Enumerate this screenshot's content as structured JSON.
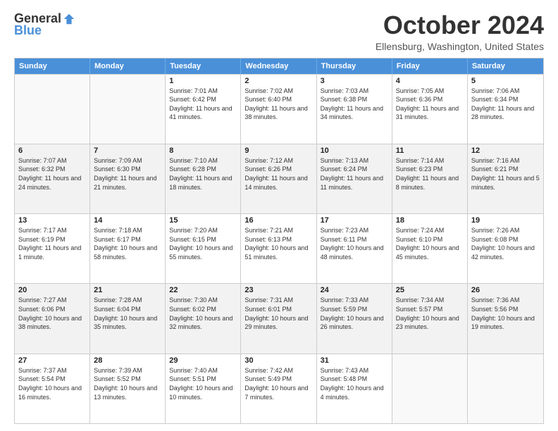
{
  "logo": {
    "general": "General",
    "blue": "Blue"
  },
  "title": "October 2024",
  "location": "Ellensburg, Washington, United States",
  "days_of_week": [
    "Sunday",
    "Monday",
    "Tuesday",
    "Wednesday",
    "Thursday",
    "Friday",
    "Saturday"
  ],
  "weeks": [
    [
      {
        "day": "",
        "empty": true
      },
      {
        "day": "",
        "empty": true
      },
      {
        "day": "1",
        "sunrise": "Sunrise: 7:01 AM",
        "sunset": "Sunset: 6:42 PM",
        "daylight": "Daylight: 11 hours and 41 minutes."
      },
      {
        "day": "2",
        "sunrise": "Sunrise: 7:02 AM",
        "sunset": "Sunset: 6:40 PM",
        "daylight": "Daylight: 11 hours and 38 minutes."
      },
      {
        "day": "3",
        "sunrise": "Sunrise: 7:03 AM",
        "sunset": "Sunset: 6:38 PM",
        "daylight": "Daylight: 11 hours and 34 minutes."
      },
      {
        "day": "4",
        "sunrise": "Sunrise: 7:05 AM",
        "sunset": "Sunset: 6:36 PM",
        "daylight": "Daylight: 11 hours and 31 minutes."
      },
      {
        "day": "5",
        "sunrise": "Sunrise: 7:06 AM",
        "sunset": "Sunset: 6:34 PM",
        "daylight": "Daylight: 11 hours and 28 minutes."
      }
    ],
    [
      {
        "day": "6",
        "sunrise": "Sunrise: 7:07 AM",
        "sunset": "Sunset: 6:32 PM",
        "daylight": "Daylight: 11 hours and 24 minutes."
      },
      {
        "day": "7",
        "sunrise": "Sunrise: 7:09 AM",
        "sunset": "Sunset: 6:30 PM",
        "daylight": "Daylight: 11 hours and 21 minutes."
      },
      {
        "day": "8",
        "sunrise": "Sunrise: 7:10 AM",
        "sunset": "Sunset: 6:28 PM",
        "daylight": "Daylight: 11 hours and 18 minutes."
      },
      {
        "day": "9",
        "sunrise": "Sunrise: 7:12 AM",
        "sunset": "Sunset: 6:26 PM",
        "daylight": "Daylight: 11 hours and 14 minutes."
      },
      {
        "day": "10",
        "sunrise": "Sunrise: 7:13 AM",
        "sunset": "Sunset: 6:24 PM",
        "daylight": "Daylight: 11 hours and 11 minutes."
      },
      {
        "day": "11",
        "sunrise": "Sunrise: 7:14 AM",
        "sunset": "Sunset: 6:23 PM",
        "daylight": "Daylight: 11 hours and 8 minutes."
      },
      {
        "day": "12",
        "sunrise": "Sunrise: 7:16 AM",
        "sunset": "Sunset: 6:21 PM",
        "daylight": "Daylight: 11 hours and 5 minutes."
      }
    ],
    [
      {
        "day": "13",
        "sunrise": "Sunrise: 7:17 AM",
        "sunset": "Sunset: 6:19 PM",
        "daylight": "Daylight: 11 hours and 1 minute."
      },
      {
        "day": "14",
        "sunrise": "Sunrise: 7:18 AM",
        "sunset": "Sunset: 6:17 PM",
        "daylight": "Daylight: 10 hours and 58 minutes."
      },
      {
        "day": "15",
        "sunrise": "Sunrise: 7:20 AM",
        "sunset": "Sunset: 6:15 PM",
        "daylight": "Daylight: 10 hours and 55 minutes."
      },
      {
        "day": "16",
        "sunrise": "Sunrise: 7:21 AM",
        "sunset": "Sunset: 6:13 PM",
        "daylight": "Daylight: 10 hours and 51 minutes."
      },
      {
        "day": "17",
        "sunrise": "Sunrise: 7:23 AM",
        "sunset": "Sunset: 6:11 PM",
        "daylight": "Daylight: 10 hours and 48 minutes."
      },
      {
        "day": "18",
        "sunrise": "Sunrise: 7:24 AM",
        "sunset": "Sunset: 6:10 PM",
        "daylight": "Daylight: 10 hours and 45 minutes."
      },
      {
        "day": "19",
        "sunrise": "Sunrise: 7:26 AM",
        "sunset": "Sunset: 6:08 PM",
        "daylight": "Daylight: 10 hours and 42 minutes."
      }
    ],
    [
      {
        "day": "20",
        "sunrise": "Sunrise: 7:27 AM",
        "sunset": "Sunset: 6:06 PM",
        "daylight": "Daylight: 10 hours and 38 minutes."
      },
      {
        "day": "21",
        "sunrise": "Sunrise: 7:28 AM",
        "sunset": "Sunset: 6:04 PM",
        "daylight": "Daylight: 10 hours and 35 minutes."
      },
      {
        "day": "22",
        "sunrise": "Sunrise: 7:30 AM",
        "sunset": "Sunset: 6:02 PM",
        "daylight": "Daylight: 10 hours and 32 minutes."
      },
      {
        "day": "23",
        "sunrise": "Sunrise: 7:31 AM",
        "sunset": "Sunset: 6:01 PM",
        "daylight": "Daylight: 10 hours and 29 minutes."
      },
      {
        "day": "24",
        "sunrise": "Sunrise: 7:33 AM",
        "sunset": "Sunset: 5:59 PM",
        "daylight": "Daylight: 10 hours and 26 minutes."
      },
      {
        "day": "25",
        "sunrise": "Sunrise: 7:34 AM",
        "sunset": "Sunset: 5:57 PM",
        "daylight": "Daylight: 10 hours and 23 minutes."
      },
      {
        "day": "26",
        "sunrise": "Sunrise: 7:36 AM",
        "sunset": "Sunset: 5:56 PM",
        "daylight": "Daylight: 10 hours and 19 minutes."
      }
    ],
    [
      {
        "day": "27",
        "sunrise": "Sunrise: 7:37 AM",
        "sunset": "Sunset: 5:54 PM",
        "daylight": "Daylight: 10 hours and 16 minutes."
      },
      {
        "day": "28",
        "sunrise": "Sunrise: 7:39 AM",
        "sunset": "Sunset: 5:52 PM",
        "daylight": "Daylight: 10 hours and 13 minutes."
      },
      {
        "day": "29",
        "sunrise": "Sunrise: 7:40 AM",
        "sunset": "Sunset: 5:51 PM",
        "daylight": "Daylight: 10 hours and 10 minutes."
      },
      {
        "day": "30",
        "sunrise": "Sunrise: 7:42 AM",
        "sunset": "Sunset: 5:49 PM",
        "daylight": "Daylight: 10 hours and 7 minutes."
      },
      {
        "day": "31",
        "sunrise": "Sunrise: 7:43 AM",
        "sunset": "Sunset: 5:48 PM",
        "daylight": "Daylight: 10 hours and 4 minutes."
      },
      {
        "day": "",
        "empty": true
      },
      {
        "day": "",
        "empty": true
      }
    ]
  ]
}
